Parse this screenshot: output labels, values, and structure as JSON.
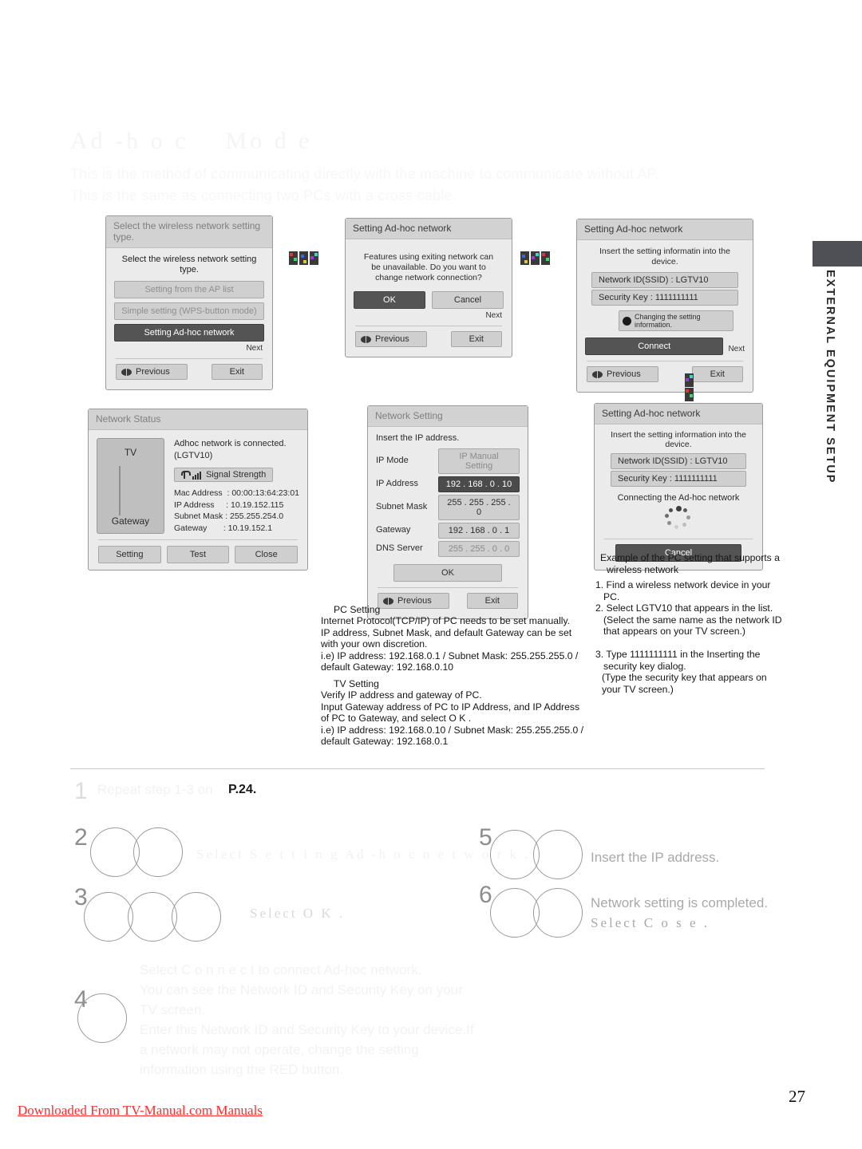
{
  "page": {
    "heading": "Ad -h o c    Mo d e",
    "intro": "This is the method of communicating directly with the machine to communicate without AP.\nThis is the same as connecting two PCs with a cross cable.",
    "side_tab": "EXTERNAL EQUIPMENT SETUP",
    "page_number": "27",
    "footer_note": "Downloaded From TV-Manual.com Manuals"
  },
  "dialog1": {
    "title": "Select the wireless network setting type.",
    "desc": "Select the wireless network setting type.",
    "options": [
      "Setting from the AP list",
      "Simple setting (WPS-button mode)",
      "Setting Ad-hoc network"
    ],
    "next": "Next",
    "previous": "Previous",
    "exit": "Exit"
  },
  "dialog2": {
    "title": "Setting Ad-hoc network",
    "desc": "Features using exiting network can be unavailable. Do you want to change network connection?",
    "ok": "OK",
    "cancel": "Cancel",
    "next": "Next",
    "previous": "Previous",
    "exit": "Exit"
  },
  "dialog3": {
    "title": "Setting Ad-hoc network",
    "desc": "Insert the setting informatin into the device.",
    "network_id": "Network ID(SSID) : LGTV10",
    "security_key": "Security Key : 1111111111",
    "changing": "Changing the setting information.",
    "connect": "Connect",
    "next": "Next",
    "previous": "Previous",
    "exit": "Exit"
  },
  "dialog4": {
    "title": "Network Status",
    "tv_label": "TV",
    "gateway_label": "Gateway",
    "status_line1": "Adhoc network is connected.",
    "status_line2": "(LGTV10)",
    "signal_strength": "Signal Strength",
    "details": "Mac Address  : 00:00:13:64:23:01\nIP Address     : 10.19.152.115\nSubnet Mask : 255.255.254.0\nGateway       : 10.19.152.1",
    "setting": "Setting",
    "test": "Test",
    "close": "Close"
  },
  "dialog5": {
    "title": "Network Setting",
    "desc": "Insert the IP address.",
    "rows": [
      {
        "label": "IP Mode",
        "value": "IP Manual Setting"
      },
      {
        "label": "IP Address",
        "value": "192 . 168 . 0 . 10"
      },
      {
        "label": "Subnet Mask",
        "value": "255 . 255 . 255 . 0"
      },
      {
        "label": "Gateway",
        "value": "192 . 168 . 0 . 1"
      },
      {
        "label": "DNS Server",
        "value": "255 . 255 . 0 . 0"
      }
    ],
    "ok": "OK",
    "previous": "Previous",
    "exit": "Exit"
  },
  "dialog6": {
    "title": "Setting Ad-hoc network",
    "desc": "Insert the setting information into the device.",
    "network_id": "Network ID(SSID) : LGTV10",
    "security_key": "Security Key : 1111111111",
    "connecting": "Connecting the Ad-hoc network",
    "cancel": "Cancel"
  },
  "notes": {
    "pc_setting_head": "PC Setting",
    "pc_setting_body": "Internet Protocol(TCP/IP) of PC needs to be set manually.\nIP address, Subnet Mask, and default Gateway can be set with your own discretion.\ni.e) IP address: 192.168.0.1 / Subnet Mask: 255.255.255.0 / default Gateway: 192.168.0.10",
    "tv_setting_head": "TV Setting",
    "tv_setting_body": "Verify IP address and gateway of PC.\nInput Gateway address of PC to IP Address, and IP Address of PC to Gateway, and select O K .\ni.e) IP address: 192.168.0.10 / Subnet Mask: 255.255.255.0 / default Gateway: 192.168.0.1"
  },
  "example": {
    "heading": "Example of the PC setting that supports a wireless network",
    "items": [
      "1. Find a wireless network device in your PC.",
      "2. Select LGTV10 that appears in the list. (Select the same name as the network ID that appears on your TV screen.)",
      "3. Type 1111111111 in the Inserting the security key dialog.",
      "(Type the security key that appears on your TV screen.)"
    ]
  },
  "steps": {
    "s1_num": "1",
    "s1_text": "Repeat step 1-3 on ",
    "s1_page": "P.24.",
    "s2_num": "2",
    "s2_text": "Select S e t t i n g   Ad -h o c   n e t w o r k .",
    "s3_num": "3",
    "s3_text": "Select O K .",
    "s4_num": "4",
    "s4_text": "Select C o n n e c t   to connect Ad-hoc network.\nYou can see the Network ID and Security Key on your TV screen.\nEnter this Network ID and Security Key to your device.If a network may not operate, change the setting information using the RED button.",
    "s5_num": "5",
    "s5_text": "Insert the IP address.",
    "s6_num": "6",
    "s6_text_a": "Network setting is completed.",
    "s6_text_b": "Select C o s e ."
  }
}
